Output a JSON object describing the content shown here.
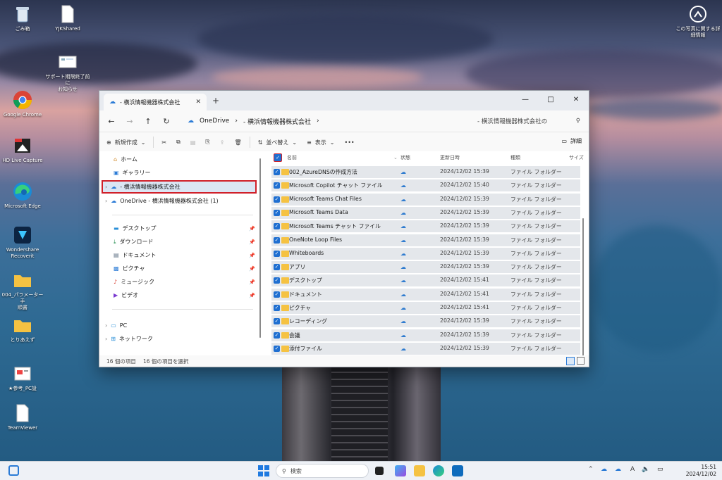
{
  "desktop": {
    "icons": [
      {
        "label": "ごみ箱"
      },
      {
        "label": "YJKShared"
      },
      {
        "label": "サポート期限終了前に\nお知らせ"
      },
      {
        "label": "Google Chrome"
      },
      {
        "label": "HD Live Capture"
      },
      {
        "label": "Microsoft Edge"
      },
      {
        "label": "Wondershare\nRecoverit"
      },
      {
        "label": "004_パラメーター手\n順書"
      },
      {
        "label": "とりあえず"
      },
      {
        "label": "★参考_PC設"
      },
      {
        "label": "TeamViewer"
      }
    ],
    "spotlight_label": "この写真に関する詳\n細情報",
    "colors": {
      "folder": "#f5c242",
      "accent": "#1f6fd1",
      "highlight_border": "#d0202a"
    }
  },
  "explorer": {
    "tab_title": "- 横浜情報機器株式会社",
    "new_tab": "+",
    "window_controls": {
      "minimize": "—",
      "maximize": "□",
      "close": "✕"
    },
    "breadcrumb": [
      "OneDrive",
      "- 横浜情報機器株式会社"
    ],
    "search_placeholder": "- 横浜情報機器株式会社の",
    "toolbar": {
      "new_label": "新規作成",
      "sort_label": "並べ替え",
      "view_label": "表示",
      "more_label": "•••",
      "details_label": "詳細"
    },
    "sidebar": {
      "home": "ホーム",
      "gallery": "ギャラリー",
      "selected": "- 横浜情報機器株式会社",
      "onedrive": "OneDrive - 横浜情報機器株式会社 (1)",
      "quick": [
        {
          "label": "デスクトップ"
        },
        {
          "label": "ダウンロード"
        },
        {
          "label": "ドキュメント"
        },
        {
          "label": "ピクチャ"
        },
        {
          "label": "ミュージック"
        },
        {
          "label": "ビデオ"
        }
      ],
      "pc": "PC",
      "network": "ネットワーク"
    },
    "columns": {
      "name": "名前",
      "status": "状態",
      "modified": "更新日時",
      "type": "種類",
      "size": "サイズ"
    },
    "rows": [
      {
        "name": "002_AzureDNSの作成方法",
        "date": "2024/12/02 15:39",
        "type": "ファイル フォルダー"
      },
      {
        "name": "Microsoft Copilot チャット ファイル",
        "date": "2024/12/02 15:40",
        "type": "ファイル フォルダー"
      },
      {
        "name": "Microsoft Teams Chat Files",
        "date": "2024/12/02 15:39",
        "type": "ファイル フォルダー"
      },
      {
        "name": "Microsoft Teams Data",
        "date": "2024/12/02 15:39",
        "type": "ファイル フォルダー"
      },
      {
        "name": "Microsoft Teams チャット ファイル",
        "date": "2024/12/02 15:39",
        "type": "ファイル フォルダー"
      },
      {
        "name": "OneNote Loop Files",
        "date": "2024/12/02 15:39",
        "type": "ファイル フォルダー"
      },
      {
        "name": "Whiteboards",
        "date": "2024/12/02 15:39",
        "type": "ファイル フォルダー"
      },
      {
        "name": "アプリ",
        "date": "2024/12/02 15:39",
        "type": "ファイル フォルダー"
      },
      {
        "name": "デスクトップ",
        "date": "2024/12/02 15:41",
        "type": "ファイル フォルダー"
      },
      {
        "name": "ドキュメント",
        "date": "2024/12/02 15:41",
        "type": "ファイル フォルダー"
      },
      {
        "name": "ピクチャ",
        "date": "2024/12/02 15:41",
        "type": "ファイル フォルダー"
      },
      {
        "name": "レコーディング",
        "date": "2024/12/02 15:39",
        "type": "ファイル フォルダー"
      },
      {
        "name": "会議",
        "date": "2024/12/02 15:39",
        "type": "ファイル フォルダー"
      },
      {
        "name": "添付ファイル",
        "date": "2024/12/02 15:39",
        "type": "ファイル フォルダー"
      }
    ],
    "status": {
      "items": "16 個の項目",
      "selected": "16 個の項目を選択"
    }
  },
  "taskbar": {
    "search_label": "検索",
    "tray": {
      "ime": "A",
      "time": "15:51",
      "date": "2024/12/02"
    }
  }
}
